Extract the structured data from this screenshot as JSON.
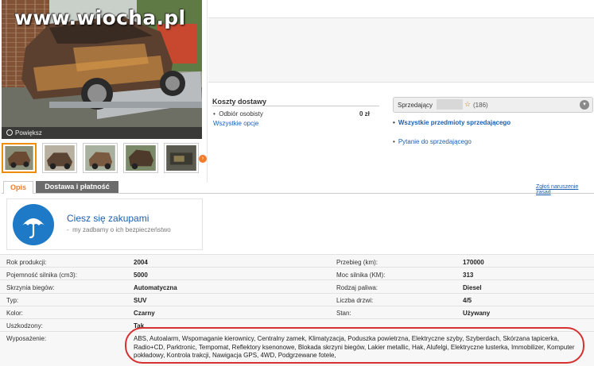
{
  "photo": {
    "watermark": "www.wiocha.pl",
    "zoom_label": "Powiększ"
  },
  "delivery": {
    "title": "Koszty dostawy",
    "pickup_label": "Odbiór osobisty",
    "pickup_price": "0 zł",
    "all_options": "Wszystkie opcje"
  },
  "seller": {
    "label": "Sprzedający",
    "rating_count": "(186)",
    "all_items": "Wszystkie przedmioty sprzedającego",
    "ask": "Pytanie do sprzedającego"
  },
  "tabs": [
    {
      "label": "Opis"
    },
    {
      "label": "Dostawa i płatność"
    }
  ],
  "report": "Zgłoś naruszenie zasad",
  "promo": {
    "title": "Ciesz się zakupami",
    "subtitle": "my zadbamy o ich bezpieczeństwo"
  },
  "params": {
    "left": [
      {
        "label": "Rok produkcji:",
        "value": "2004"
      },
      {
        "label": "Pojemność silnika (cm3):",
        "value": "5000"
      },
      {
        "label": "Skrzynia biegów:",
        "value": "Automatyczna"
      },
      {
        "label": "Typ:",
        "value": "SUV"
      },
      {
        "label": "Kolor:",
        "value": "Czarny"
      },
      {
        "label": "Uszkodzony:",
        "value": "Tak"
      }
    ],
    "right": [
      {
        "label": "Przebieg (km):",
        "value": "170000"
      },
      {
        "label": "Moc silnika (KM):",
        "value": "313"
      },
      {
        "label": "Rodzaj paliwa:",
        "value": "Diesel"
      },
      {
        "label": "Liczba drzwi:",
        "value": "4/5"
      },
      {
        "label": "Stan:",
        "value": "Używany"
      }
    ],
    "equipment_label": "Wyposażenie:",
    "equipment_value": "ABS, Autoalarm, Wspomaganie kierownicy, Centralny zamek, Klimatyzacja, Poduszka powietrzna, Elektryczne szyby, Szyberdach, Skórzana tapicerka, Radio+CD, Parktronic, Tempomat, Reflektory ksenonowe, Blokada skrzyni biegów, Lakier metallic, Hak, Alufelgi, Elektryczne lusterka, Immobilizer, Komputer pokładowy, Kontrola trakcji, Nawigacja GPS, 4WD, Podgrzewane fotele,"
  }
}
